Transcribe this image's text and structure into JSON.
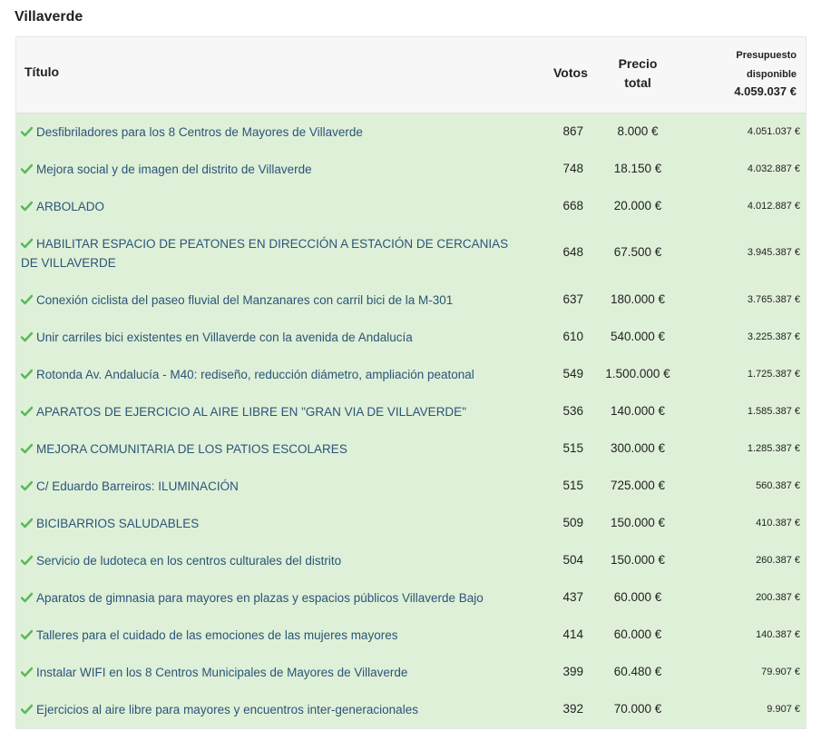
{
  "district": "Villaverde",
  "header": {
    "title": "Título",
    "votes": "Votos",
    "price_line1": "Precio",
    "price_line2": "total",
    "budget_line1": "Presupuesto",
    "budget_line2": "disponible",
    "budget_value": "4.059.037 €"
  },
  "colors": {
    "row_bg": "#dff0d8",
    "check": "#5cb85c",
    "link": "#2a5578"
  },
  "rows": [
    {
      "title": "Desfibriladores para los 8 Centros de Mayores de Villaverde",
      "votes": "867",
      "price": "8.000 €",
      "remaining": "4.051.037 €"
    },
    {
      "title": "Mejora social y de imagen del distrito de Villaverde",
      "votes": "748",
      "price": "18.150 €",
      "remaining": "4.032.887 €"
    },
    {
      "title": "ARBOLADO",
      "votes": "668",
      "price": "20.000 €",
      "remaining": "4.012.887 €"
    },
    {
      "title": "HABILITAR ESPACIO DE PEATONES EN DIRECCIÓN A ESTACIÓN DE CERCANIAS DE VILLAVERDE",
      "votes": "648",
      "price": "67.500 €",
      "remaining": "3.945.387 €"
    },
    {
      "title": "Conexión ciclista del paseo fluvial del Manzanares con carril bici de la M-301",
      "votes": "637",
      "price": "180.000 €",
      "remaining": "3.765.387 €"
    },
    {
      "title": "Unir carriles bici existentes en Villaverde con la avenida de Andalucía",
      "votes": "610",
      "price": "540.000 €",
      "remaining": "3.225.387 €"
    },
    {
      "title": "Rotonda Av. Andalucía - M40: rediseño, reducción diámetro, ampliación peatonal",
      "votes": "549",
      "price": "1.500.000 €",
      "remaining": "1.725.387 €"
    },
    {
      "title": "APARATOS DE EJERCICIO AL AIRE LIBRE EN \"GRAN VIA DE VILLAVERDE\"",
      "votes": "536",
      "price": "140.000 €",
      "remaining": "1.585.387 €"
    },
    {
      "title": "MEJORA COMUNITARIA DE LOS PATIOS ESCOLARES",
      "votes": "515",
      "price": "300.000 €",
      "remaining": "1.285.387 €"
    },
    {
      "title": "C/ Eduardo Barreiros: ILUMINACIÓN",
      "votes": "515",
      "price": "725.000 €",
      "remaining": "560.387 €"
    },
    {
      "title": "BICIBARRIOS SALUDABLES",
      "votes": "509",
      "price": "150.000 €",
      "remaining": "410.387 €"
    },
    {
      "title": "Servicio de ludoteca en los centros culturales del distrito",
      "votes": "504",
      "price": "150.000 €",
      "remaining": "260.387 €"
    },
    {
      "title": "Aparatos de gimnasia para mayores en plazas y espacios públicos Villaverde Bajo",
      "votes": "437",
      "price": "60.000 €",
      "remaining": "200.387 €"
    },
    {
      "title": "Talleres para el cuidado de las emociones de las mujeres mayores",
      "votes": "414",
      "price": "60.000 €",
      "remaining": "140.387 €"
    },
    {
      "title": "Instalar WIFI en los 8 Centros Municipales de Mayores de Villaverde",
      "votes": "399",
      "price": "60.480 €",
      "remaining": "79.907 €"
    },
    {
      "title": "Ejercicios al aire libre para mayores y encuentros inter-generacionales",
      "votes": "392",
      "price": "70.000 €",
      "remaining": "9.907 €"
    }
  ]
}
